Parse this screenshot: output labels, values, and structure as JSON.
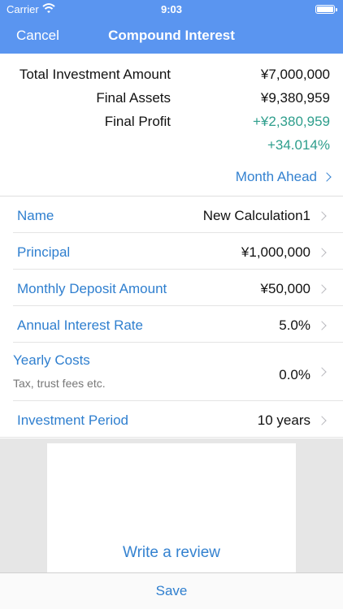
{
  "status_bar": {
    "carrier": "Carrier",
    "time": "9:03"
  },
  "navbar": {
    "cancel_label": "Cancel",
    "title": "Compound Interest"
  },
  "summary": {
    "total_investment_label": "Total Investment Amount",
    "total_investment_value": "¥7,000,000",
    "final_assets_label": "Final Assets",
    "final_assets_value": "¥9,380,959",
    "final_profit_label": "Final Profit",
    "final_profit_value": "+¥2,380,959",
    "final_profit_percent": "+34.014%",
    "month_ahead_label": "Month Ahead"
  },
  "fields": {
    "name": {
      "label": "Name",
      "value": "New Calculation1"
    },
    "principal": {
      "label": "Principal",
      "value": "¥1,000,000"
    },
    "monthly_deposit": {
      "label": "Monthly Deposit Amount",
      "value": "¥50,000"
    },
    "annual_rate": {
      "label": "Annual Interest Rate",
      "value": "5.0%"
    },
    "yearly_costs": {
      "label": "Yearly Costs",
      "sublabel": "Tax, trust fees etc.",
      "value": "0.0%"
    },
    "period": {
      "label": "Investment Period",
      "value": "10 years"
    }
  },
  "ad": {
    "review_label": "Write a review"
  },
  "bottom": {
    "save_label": "Save"
  },
  "colors": {
    "nav_bg": "#5a95f0",
    "accent": "#2f7fcf",
    "profit_green": "#2e9e8c"
  },
  "icons": [
    "wifi-icon",
    "battery-icon",
    "chevron-right-icon"
  ]
}
